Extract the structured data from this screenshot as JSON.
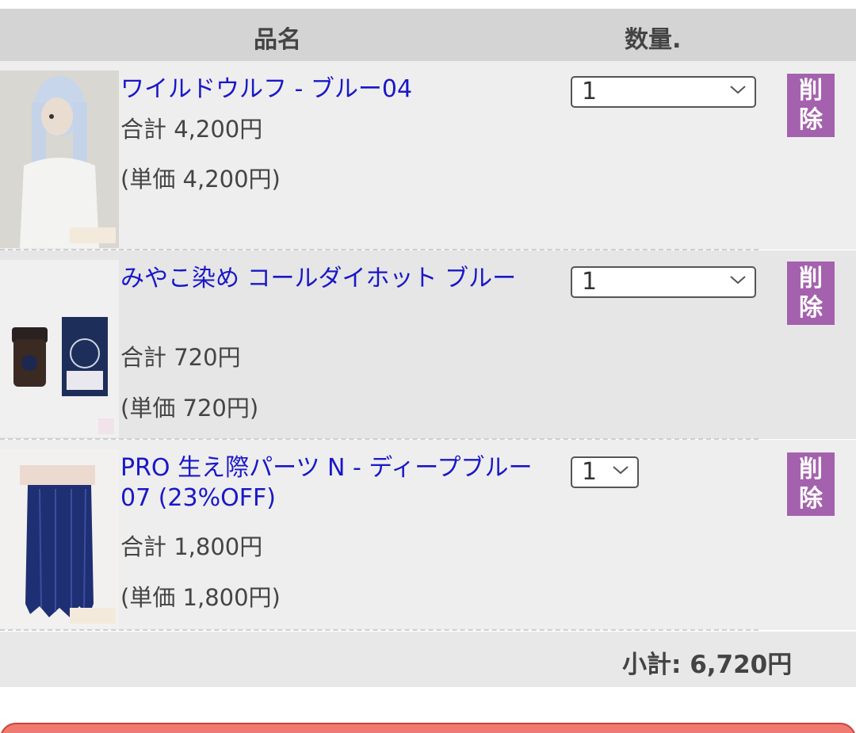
{
  "header": {
    "name_label": "品名",
    "qty_label": "数量."
  },
  "items": [
    {
      "name": "ワイルドウルフ - ブルー04",
      "total": "合計 4,200円",
      "unit": "(単価 4,200円)",
      "qty": "1",
      "delete_top": "削",
      "delete_bottom": "除"
    },
    {
      "name": "みやこ染め コールダイホット ブルー",
      "total": "合計 720円",
      "unit": "(単価 720円)",
      "qty": "1",
      "delete_top": "削",
      "delete_bottom": "除"
    },
    {
      "name": "PRO 生え際パーツ N - ディープブルー07 (23%OFF)",
      "total": "合計 1,800円",
      "unit": "(単価 1,800円)",
      "qty": "1",
      "delete_top": "削",
      "delete_bottom": "除"
    }
  ],
  "subtotal": "小計: 6,720円",
  "colors": {
    "link": "#1a17c8",
    "delete_button": "#a461ad",
    "header_bg": "#d4d4d4",
    "checkout_button": "#f07a70"
  },
  "icons": [
    "chevron-down-icon"
  ]
}
